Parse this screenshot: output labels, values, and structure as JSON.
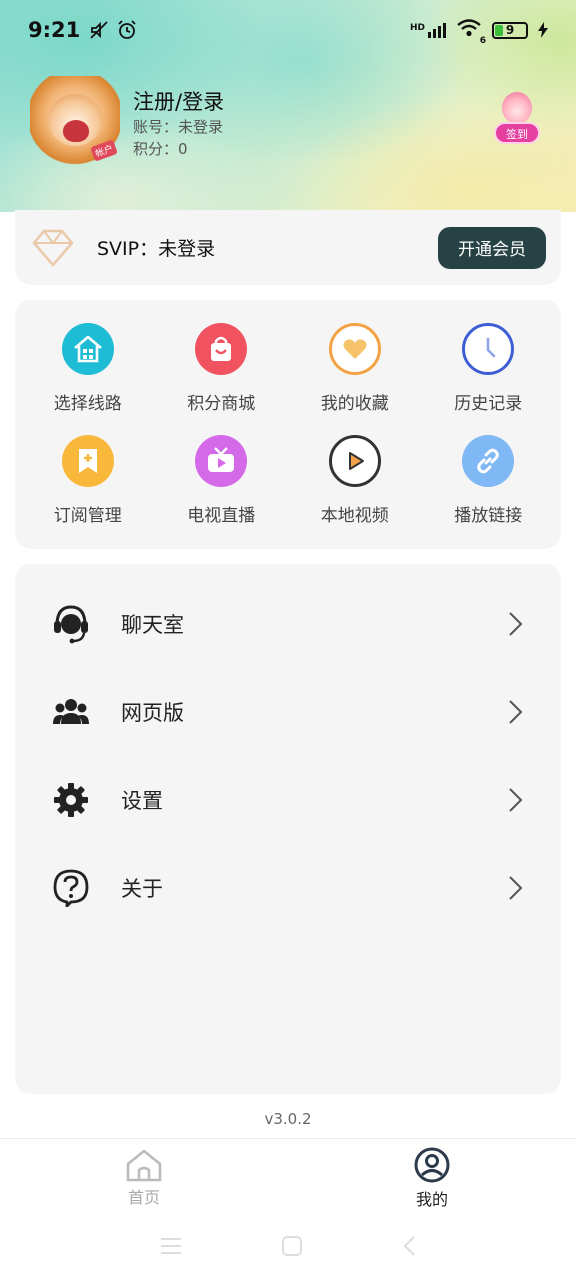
{
  "status": {
    "time": "9:21",
    "network": "HD",
    "wifi_badge": "6",
    "battery": "9"
  },
  "profile": {
    "avatar_badge": "帐户",
    "name": "注册/登录",
    "account": "账号：未登录",
    "points": "积分：0",
    "checkin_label": "签到"
  },
  "svip": {
    "label": "SVIP：未登录",
    "button": "开通会员"
  },
  "grid": [
    {
      "label": "选择线路",
      "icon": "house-icon",
      "color": "#1fbcd6"
    },
    {
      "label": "积分商城",
      "icon": "shopping-bag-icon",
      "color": "#f0525f"
    },
    {
      "label": "我的收藏",
      "icon": "heart-icon",
      "color": "#f3a344"
    },
    {
      "label": "历史记录",
      "icon": "clock-icon",
      "color": "#3e5ed6"
    },
    {
      "label": "订阅管理",
      "icon": "bookmark-plus-icon",
      "color": "#f9b83c"
    },
    {
      "label": "电视直播",
      "icon": "tv-icon",
      "color": "#d46ae8"
    },
    {
      "label": "本地视频",
      "icon": "play-circle-icon",
      "color": "#333333"
    },
    {
      "label": "播放链接",
      "icon": "link-icon",
      "color": "#7fb8f5"
    }
  ],
  "menu": [
    {
      "label": "聊天室",
      "icon": "headset-icon"
    },
    {
      "label": "网页版",
      "icon": "users-icon"
    },
    {
      "label": "设置",
      "icon": "gear-icon"
    },
    {
      "label": "关于",
      "icon": "question-icon"
    }
  ],
  "version": "v3.0.2",
  "nav": {
    "home": "首页",
    "me": "我的"
  }
}
